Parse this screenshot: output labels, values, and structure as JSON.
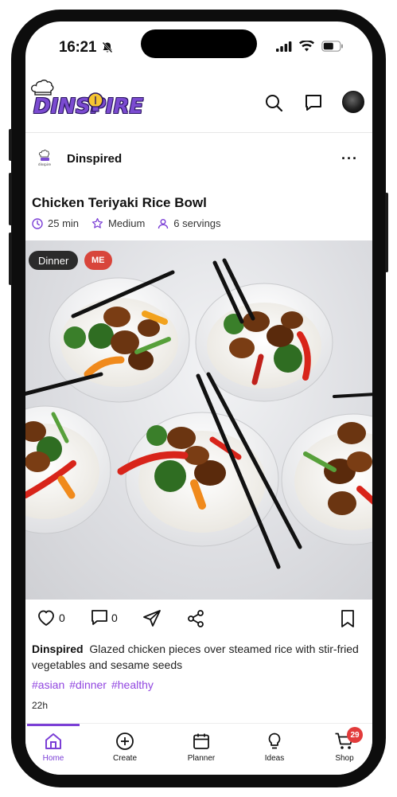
{
  "status_bar": {
    "time": "16:21"
  },
  "app": {
    "logo_text": "DINSPIRE"
  },
  "post": {
    "author": "Dinspired",
    "title": "Chicken Teriyaki Rice Bowl",
    "meta": {
      "time": "25 min",
      "difficulty": "Medium",
      "servings": "6 servings"
    },
    "tags": [
      "Dinner",
      "ME"
    ],
    "likes": "0",
    "comments": "0",
    "caption_author": "Dinspired",
    "caption": "Glazed chicken pieces over steamed rice with stir-fried vegetables and sesame seeds",
    "hashtags": [
      "#asian",
      "#dinner",
      "#healthy"
    ],
    "age": "22h"
  },
  "nav": {
    "items": [
      {
        "label": "Home",
        "icon": "home-icon",
        "active": true
      },
      {
        "label": "Create",
        "icon": "plus-circle-icon"
      },
      {
        "label": "Planner",
        "icon": "calendar-icon"
      },
      {
        "label": "Ideas",
        "icon": "lightbulb-icon"
      },
      {
        "label": "Shop",
        "icon": "cart-icon",
        "badge": "29"
      }
    ]
  },
  "colors": {
    "accent": "#7b3fd6",
    "hashtag": "#9146e0",
    "badge": "#e23b3b",
    "me_tag": "#d8453b"
  }
}
